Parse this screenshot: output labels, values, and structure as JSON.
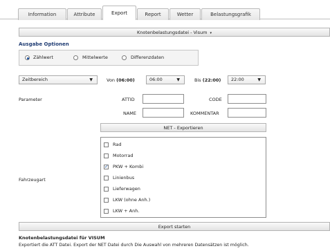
{
  "tabs": [
    {
      "label": "Information"
    },
    {
      "label": "Attribute"
    },
    {
      "label": "Export"
    },
    {
      "label": "Report"
    },
    {
      "label": "Wetter"
    },
    {
      "label": "Belastungsgrafik"
    }
  ],
  "export_type_select": {
    "label": "Knotenbelastungsdatei - Visum",
    "caret": "▾"
  },
  "ausgabe": {
    "title": "Ausgabe Optionen",
    "options": [
      {
        "label": "Zählwert",
        "selected": true
      },
      {
        "label": "Mittelwerte",
        "selected": false
      },
      {
        "label": "Differenzdaten",
        "selected": false
      }
    ]
  },
  "zeitbereich": {
    "select_value": "Zeitbereich",
    "von_label": "Von",
    "von_value": "(06:00)",
    "von_select": "06:00",
    "bis_label": "Bis",
    "bis_value": "(22:00)",
    "bis_select": "22:00",
    "caret": "▼"
  },
  "parameter": {
    "label": "Parameter",
    "attid_label": "ATTID",
    "attid_value": "",
    "code_label": "CODE",
    "code_value": "",
    "name_label": "NAME",
    "name_value": "",
    "kommentar_label": "KOMMENTAR",
    "kommentar_value": ""
  },
  "net_export_button": "NET - Exportieren",
  "fahrzeugart": {
    "label": "Fahrzeugart",
    "items": [
      {
        "label": "Rad",
        "checked": false
      },
      {
        "label": "Motorrad",
        "checked": false
      },
      {
        "label": "PKW + Kombi",
        "checked": true
      },
      {
        "label": "Linienbus",
        "checked": false
      },
      {
        "label": "Lieferwagen",
        "checked": false
      },
      {
        "label": "LKW (ohne Anh.)",
        "checked": false
      },
      {
        "label": "LKW + Anh.",
        "checked": false
      }
    ]
  },
  "export_start_button": "Export starten",
  "info": {
    "title": "Knotenbelastungsdatei für VISUM",
    "text": "Exportiert die ATT Datei. Export der NET Datei durch Die Auswahl von mehreren Datensätzen ist möglich."
  }
}
